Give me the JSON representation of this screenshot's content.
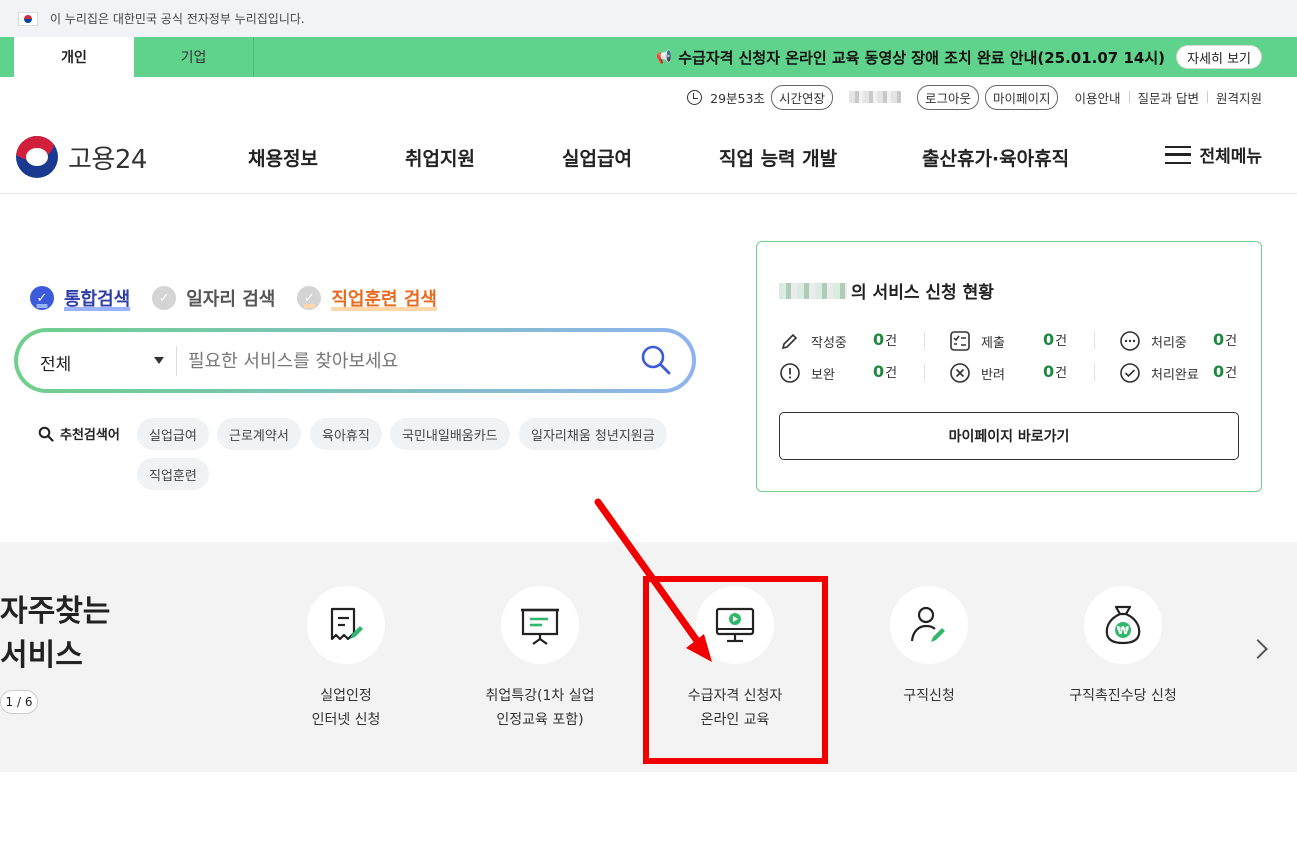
{
  "gov_bar": {
    "text": "이 누리집은 대한민국 공식 전자정부 누리집입니다."
  },
  "top_tabs": {
    "personal": "개인",
    "company": "기업"
  },
  "notice": {
    "text": "수급자격 신청자 온라인 교육 동영상 장애 조치 완료 안내(25.01.07 14시)",
    "button": "자세히 보기"
  },
  "util": {
    "timer": "29분53초",
    "extend": "시간연장",
    "logout": "로그아웃",
    "mypage": "마이페이지",
    "links": [
      "이용안내",
      "질문과 답변",
      "원격지원"
    ]
  },
  "header": {
    "logo_text": "고용24",
    "nav": [
      "채용정보",
      "취업지원",
      "실업급여",
      "직업 능력 개발",
      "출산휴가·육아휴직"
    ],
    "all_menu": "전체메뉴"
  },
  "search": {
    "tabs": [
      "통합검색",
      "일자리 검색",
      "직업훈련 검색"
    ],
    "category": "전체",
    "placeholder": "필요한 서비스를 찾아보세요",
    "recommend_label": "추천검색어",
    "keywords": [
      "실업급여",
      "근로계약서",
      "육아휴직",
      "국민내일배움카드",
      "일자리채움 청년지원금",
      "직업훈련"
    ]
  },
  "status": {
    "title_suffix": "의 서비스 신청 현황",
    "items": [
      {
        "label": "작성중",
        "count": "0",
        "unit": "건"
      },
      {
        "label": "제출",
        "count": "0",
        "unit": "건"
      },
      {
        "label": "처리중",
        "count": "0",
        "unit": "건"
      },
      {
        "label": "보완",
        "count": "0",
        "unit": "건"
      },
      {
        "label": "반려",
        "count": "0",
        "unit": "건"
      },
      {
        "label": "처리완료",
        "count": "0",
        "unit": "건"
      }
    ],
    "mypage_button": "마이페이지 바로가기"
  },
  "favorites": {
    "title_line1": "자주찾는",
    "title_line2": "서비스",
    "pager": "1 / 6",
    "services": [
      {
        "line1": "실업인정",
        "line2": "인터넷 신청",
        "icon": "document-pen-icon"
      },
      {
        "line1": "취업특강(1차 실업",
        "line2": "인정교육 포함)",
        "icon": "presentation-board-icon"
      },
      {
        "line1": "수급자격 신청자",
        "line2": "온라인 교육",
        "icon": "monitor-play-icon"
      },
      {
        "line1": "구직신청",
        "line2": "",
        "icon": "person-pen-icon"
      },
      {
        "line1": "구직촉진수당 신청",
        "line2": "",
        "icon": "money-bag-won-icon"
      }
    ]
  },
  "colors": {
    "brand_green": "#5fd38b",
    "annotation_red": "#f20000",
    "count_green": "#1d8a3f"
  }
}
